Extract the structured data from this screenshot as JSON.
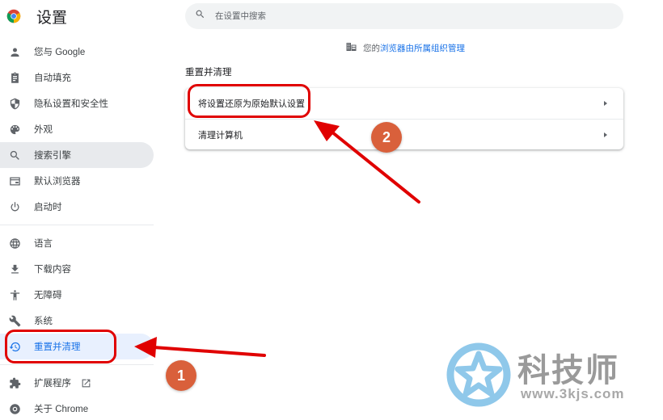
{
  "app": {
    "title": "设置"
  },
  "search": {
    "placeholder": "在设置中搜索",
    "value": ""
  },
  "managed_notice": {
    "prefix": "您的",
    "link": "浏览器由所属组织管理"
  },
  "sidebar": {
    "items": [
      {
        "label": "您与 Google",
        "icon": "person-icon"
      },
      {
        "label": "自动填充",
        "icon": "clipboard-icon"
      },
      {
        "label": "隐私设置和安全性",
        "icon": "shield-icon"
      },
      {
        "label": "外观",
        "icon": "palette-icon"
      },
      {
        "label": "搜索引擎",
        "icon": "search-icon"
      },
      {
        "label": "默认浏览器",
        "icon": "browser-window-icon"
      },
      {
        "label": "启动时",
        "icon": "power-icon"
      },
      {
        "label": "语言",
        "icon": "globe-icon"
      },
      {
        "label": "下载内容",
        "icon": "download-icon"
      },
      {
        "label": "无障碍",
        "icon": "accessibility-icon"
      },
      {
        "label": "系统",
        "icon": "wrench-icon"
      },
      {
        "label": "重置并清理",
        "icon": "restore-icon"
      },
      {
        "label": "扩展程序",
        "icon": "puzzle-icon"
      },
      {
        "label": "关于 Chrome",
        "icon": "chrome-icon"
      }
    ],
    "hovered_index": 4,
    "active_index": 11
  },
  "section": {
    "title": "重置并清理",
    "rows": [
      {
        "label": "将设置还原为原始默认设置"
      },
      {
        "label": "清理计算机"
      }
    ]
  },
  "annotations": {
    "badge1": "1",
    "badge2": "2",
    "color": "#e00000",
    "badge_color": "#d9603b"
  },
  "watermark": {
    "title": "科技师",
    "url": "www.3kjs.com"
  }
}
